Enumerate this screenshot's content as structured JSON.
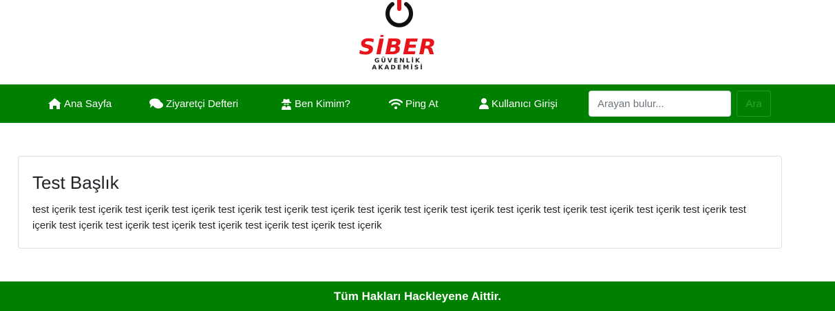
{
  "logo": {
    "brand": "SİBER",
    "subtitle": "GÜVENLİK AKADEMİSİ",
    "power_icon": "power-icon",
    "colors": {
      "brand_red": "#e8141b",
      "ring": "#111111"
    }
  },
  "navbar": {
    "color": "#008000",
    "items": [
      {
        "label": "Ana Sayfa",
        "icon": "home-icon"
      },
      {
        "label": "Ziyaretçi Defteri",
        "icon": "comments-icon"
      },
      {
        "label": "Ben Kimim?",
        "icon": "user-secret-icon"
      },
      {
        "label": "Ping At",
        "icon": "wifi-icon"
      },
      {
        "label": "Kullanıcı Girişi",
        "icon": "user-icon"
      }
    ],
    "search": {
      "placeholder": "Arayan bulur...",
      "value": "",
      "button_label": "Ara"
    }
  },
  "card": {
    "title": "Test Başlık",
    "text": "test içerik test içerik test içerik test içerik test içerik test içerik test içerik test içerik test içerik test içerik test içerik test içerik test içerik test içerik test içerik test içerik test içerik test içerik test içerik test içerik test içerik test içerik test içerik"
  },
  "footer": {
    "text": "Tüm Hakları Hackleyene Aittir.",
    "color": "#008000"
  }
}
